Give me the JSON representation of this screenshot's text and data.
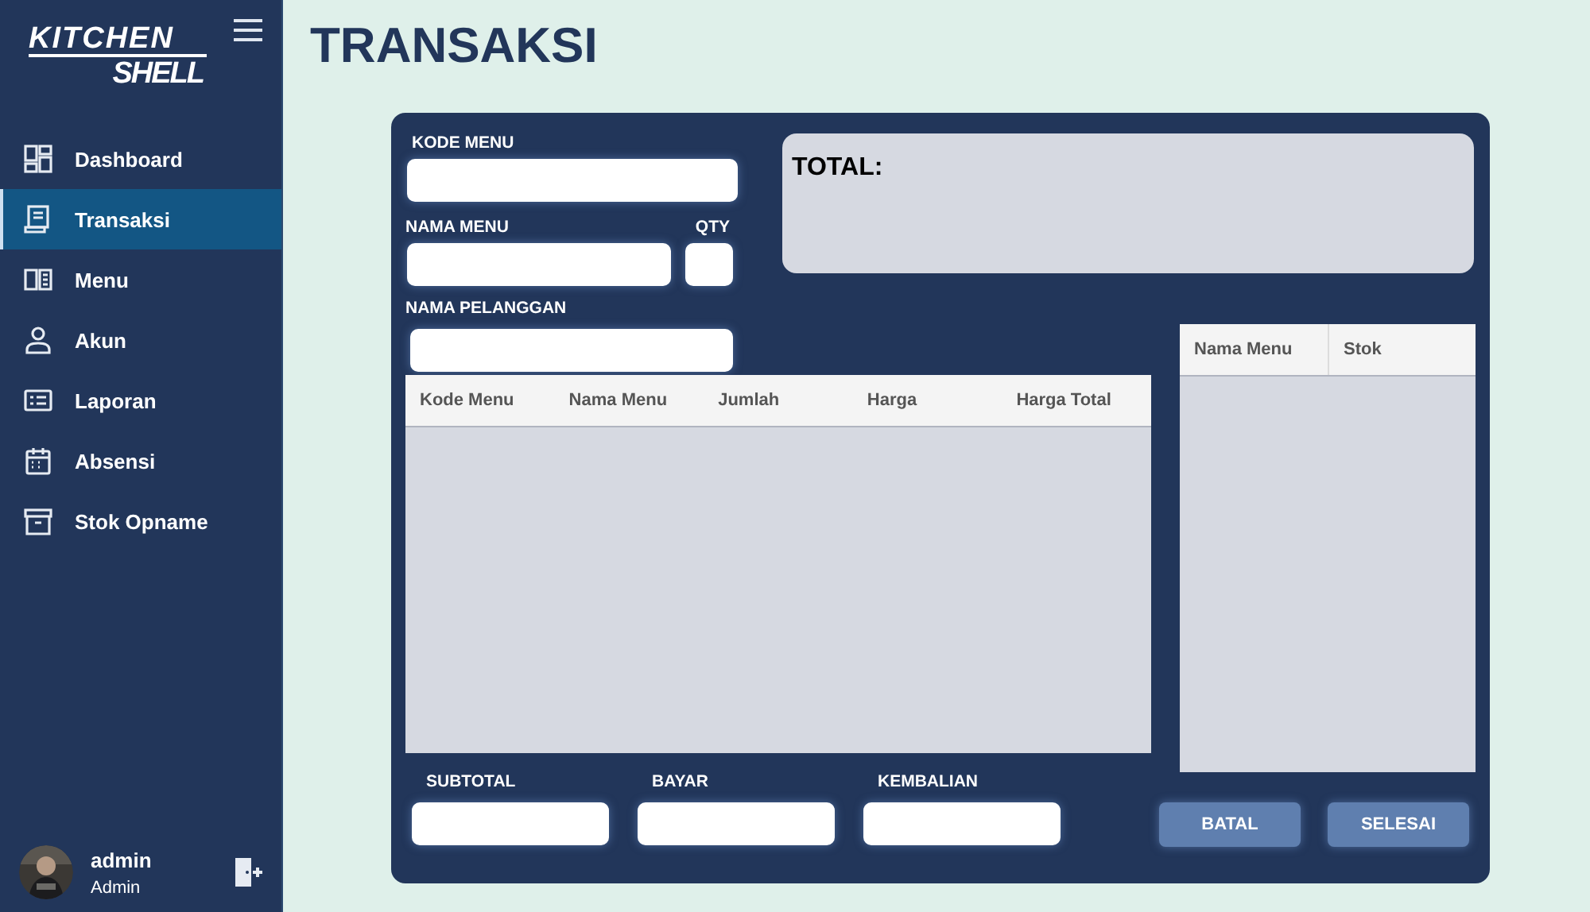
{
  "sidebar": {
    "logo": {
      "line_1": "KITCHEN",
      "line_2": "SHELL"
    },
    "items": [
      {
        "label": "Dashboard",
        "selected": false
      },
      {
        "label": "Transaksi",
        "selected": true
      },
      {
        "label": "Menu",
        "selected": false
      },
      {
        "label": "Akun",
        "selected": false
      },
      {
        "label": "Laporan",
        "selected": false
      },
      {
        "label": "Absensi",
        "selected": false
      },
      {
        "label": "Stok Opname",
        "selected": false
      }
    ],
    "user": {
      "name": "admin",
      "role": "Admin"
    }
  },
  "page_title": "TRANSAKSI",
  "form": {
    "kode_menu": {
      "label": "KODE MENU"
    },
    "nama_menu": {
      "label": "NAMA MENU"
    },
    "qty": {
      "label": "QTY"
    },
    "nama_pelanggan": {
      "label": "NAMA PELANGGAN"
    }
  },
  "total": {
    "label": "TOTAL:"
  },
  "order_table": {
    "columns": [
      "Kode Menu",
      "Nama Menu",
      "Jumlah",
      "Harga",
      "Harga Total"
    ]
  },
  "stock_table": {
    "columns": [
      "Nama Menu",
      "Stok"
    ]
  },
  "summary": [
    {
      "label": "SUBTOTAL"
    },
    {
      "label": "BAYAR"
    },
    {
      "label": "KEMBALIAN"
    }
  ],
  "buttons": [
    "BATAL",
    "SELESAI"
  ]
}
